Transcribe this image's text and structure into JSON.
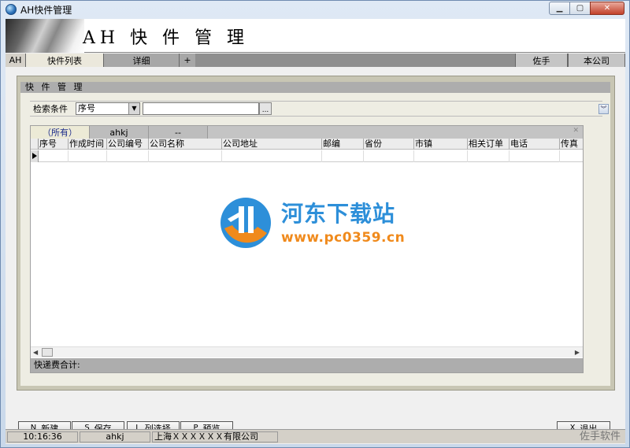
{
  "window": {
    "title": "AH快件管理"
  },
  "banner": {
    "title": "AH 快 件 管 理"
  },
  "top_tabs": {
    "ah": "AH",
    "list": "快件列表",
    "detail": "详细",
    "plus": "+",
    "assistant": "佐手",
    "company": "本公司"
  },
  "panel": {
    "title": "快 件 管 理"
  },
  "search": {
    "label": "检索条件",
    "selected": "序号",
    "browse_label": "..."
  },
  "grid": {
    "tabs": [
      "（所有）",
      "ahkj",
      "--"
    ],
    "columns": [
      "序号",
      "作成时间",
      "公司编号",
      "公司名称",
      "公司地址",
      "邮编",
      "省份",
      "市镇",
      "相关订单",
      "电话",
      "传真"
    ],
    "total_label": "快递费合计:"
  },
  "watermark": {
    "name": "河东下载站",
    "url": "www.pc0359.cn"
  },
  "buttons": {
    "new": {
      "key": "N",
      "label": "新建"
    },
    "save": {
      "key": "S",
      "label": "保存"
    },
    "columns": {
      "key": "L",
      "label": "列选择"
    },
    "preview": {
      "key": "P",
      "label": "预览"
    },
    "exit": {
      "key": "X",
      "label": "退出"
    }
  },
  "status": {
    "time": "10:16:36",
    "user": "ahkj",
    "company": "上海ＸＸＸＸＸＸ有限公司",
    "brand": "佐手软件"
  },
  "colors": {
    "watermark_blue": "#2d8fd9",
    "watermark_orange": "#f08a1c",
    "active_tab_text": "#1b2a8a"
  }
}
